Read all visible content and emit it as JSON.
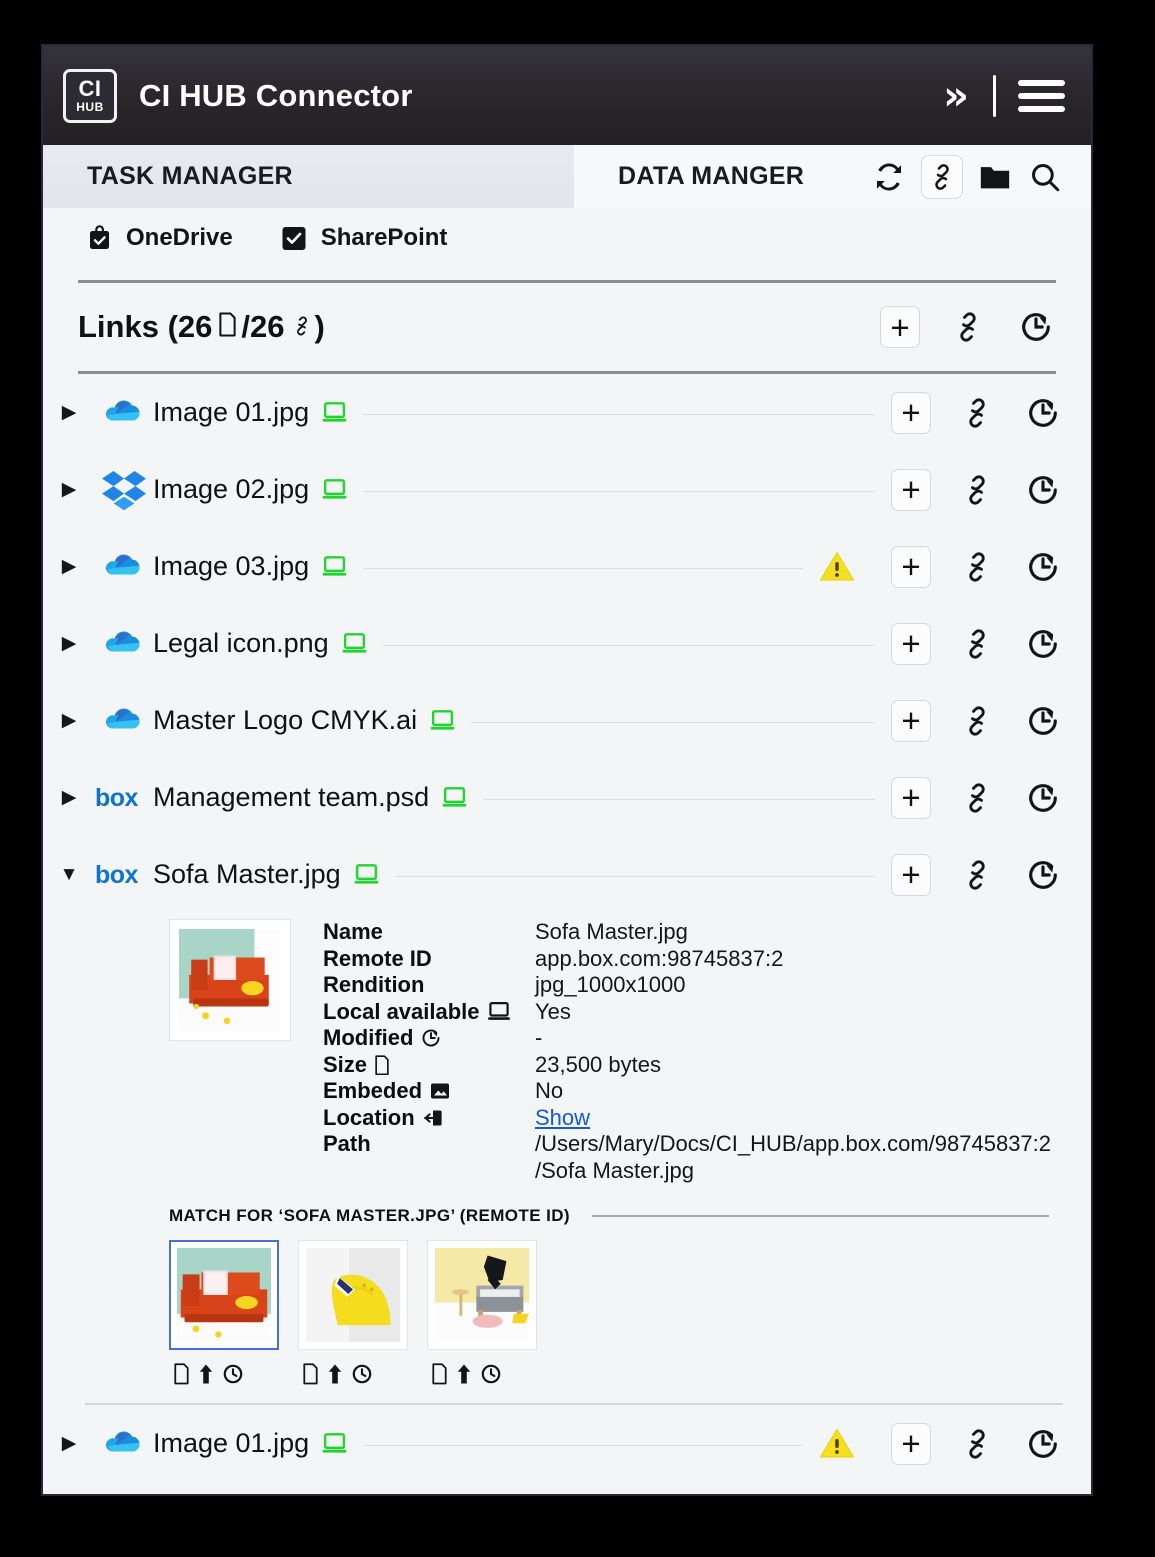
{
  "window": {
    "title": "CI HUB Connector",
    "logo_top": "CI",
    "logo_bottom": "HUB"
  },
  "titlebar": {
    "collapse_icon": "double-chevron-right-icon",
    "menu_icon": "hamburger-menu-icon"
  },
  "tabs": [
    {
      "id": "task-manager",
      "label": "TASK MANAGER",
      "active": true
    },
    {
      "id": "data-manager",
      "label": "DATA MANGER",
      "active": false
    }
  ],
  "toolbar": {
    "icons": [
      {
        "name": "refresh-sync-icon",
        "active": false
      },
      {
        "name": "link-icon",
        "active": true
      },
      {
        "name": "folder-icon",
        "active": false
      },
      {
        "name": "search-icon",
        "active": false
      }
    ]
  },
  "sources": [
    {
      "label": "OneDrive",
      "checked": true,
      "icon": "onedrive-checkbox-icon"
    },
    {
      "label": "SharePoint",
      "checked": true,
      "icon": "sharepoint-checkbox-icon"
    }
  ],
  "links": {
    "title_prefix": "Links (",
    "file_count": "26",
    "separator": " / ",
    "link_count": "26",
    "title_suffix": ")",
    "file_icon": "document-icon",
    "link_icon": "link-icon",
    "actions": [
      {
        "name": "add-link-button",
        "label": "+"
      },
      {
        "name": "relink-button",
        "label": "link-icon"
      },
      {
        "name": "history-button",
        "label": "clock-history-icon"
      }
    ]
  },
  "row_actions": {
    "add_label": "+",
    "link_name": "link-icon",
    "history_name": "clock-history-icon",
    "warning_name": "warning-triangle-icon"
  },
  "rows": [
    {
      "name": "Image 01.jpg",
      "source": "onedrive",
      "expanded": false,
      "local": true,
      "warning": false
    },
    {
      "name": "Image 02.jpg",
      "source": "dropbox",
      "expanded": false,
      "local": true,
      "warning": false
    },
    {
      "name": "Image 03.jpg",
      "source": "onedrive",
      "expanded": false,
      "local": true,
      "warning": true
    },
    {
      "name": "Legal icon.png",
      "source": "onedrive",
      "expanded": false,
      "local": true,
      "warning": false
    },
    {
      "name": "Master Logo CMYK.ai",
      "source": "onedrive",
      "expanded": false,
      "local": true,
      "warning": false
    },
    {
      "name": "Management team.psd",
      "source": "box",
      "expanded": false,
      "local": true,
      "warning": false
    },
    {
      "name": "Sofa Master.jpg",
      "source": "box",
      "expanded": true,
      "local": true,
      "warning": false
    }
  ],
  "detail": {
    "thumbnail": "orange-sofa-thumbnail",
    "fields": [
      {
        "key": "Name",
        "icon": null,
        "value": "Sofa Master.jpg"
      },
      {
        "key": "Remote ID",
        "icon": null,
        "value": "app.box.com:98745837:2"
      },
      {
        "key": "Rendition",
        "icon": null,
        "value": "jpg_1000x1000"
      },
      {
        "key": "Local available",
        "icon": "laptop-icon",
        "value": "Yes"
      },
      {
        "key": "Modified",
        "icon": "clock-history-icon",
        "value": "-"
      },
      {
        "key": "Size",
        "icon": "document-icon",
        "value": "23,500 bytes"
      },
      {
        "key": "Embeded",
        "icon": "image-icon",
        "value": "No"
      },
      {
        "key": "Location",
        "icon": "enter-arrow-icon",
        "value": "Show",
        "is_link": true
      },
      {
        "key": "Path",
        "icon": null,
        "value": "/Users/Mary/Docs/CI_HUB/app.box.com/98745837:2"
      }
    ],
    "path_line2": "/Sofa Master.jpg"
  },
  "match": {
    "title": "MATCH FOR ‘SOFA MASTER.JPG’  (REMOTE ID)",
    "items": [
      {
        "name": "orange-sofa-match",
        "selected": true
      },
      {
        "name": "yellow-sofa-match",
        "selected": false
      },
      {
        "name": "grey-sofa-match",
        "selected": false
      }
    ],
    "item_icons": [
      {
        "name": "document-icon"
      },
      {
        "name": "upload-arrow-icon"
      },
      {
        "name": "clock-icon"
      }
    ]
  },
  "footer_row": {
    "name": "Image 01.jpg",
    "source": "onedrive",
    "expanded": false,
    "local": true,
    "warning": true
  },
  "colors": {
    "accent_blue": "#1459d6",
    "warning_yellow": "#f5e020",
    "local_green": "#22d430",
    "onedrive_blue": "#28a8ea",
    "dropbox_blue": "#0f82e6",
    "box_blue": "#0d74cf",
    "titlebar_dark": "#282629",
    "panel_bg": "#f4f5f7"
  }
}
